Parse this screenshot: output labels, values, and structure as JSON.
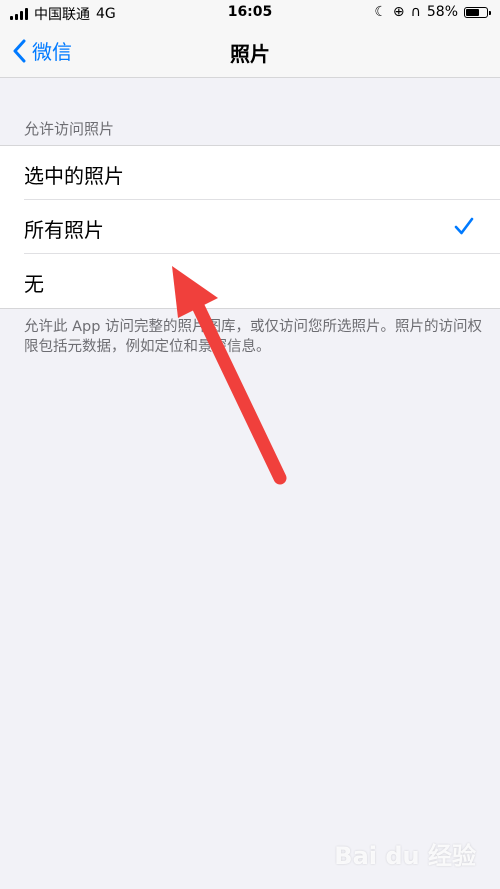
{
  "status_bar": {
    "carrier": "中国联通",
    "network": "4G",
    "time": "16:05",
    "battery_percent": "58%",
    "battery_level": 0.58
  },
  "nav": {
    "back_label": "微信",
    "title": "照片"
  },
  "section": {
    "header": "允许访问照片",
    "options": [
      {
        "label": "选中的照片",
        "checked": false
      },
      {
        "label": "所有照片",
        "checked": true
      },
      {
        "label": "无",
        "checked": false
      }
    ],
    "footer": "允许此 App 访问完整的照片图库，或仅访问您所选照片。照片的访问权限包括元数据，例如定位和景深信息。"
  },
  "watermark": "Bai du 经验",
  "colors": {
    "accent": "#007aff",
    "annotation_arrow": "#f0403c"
  }
}
